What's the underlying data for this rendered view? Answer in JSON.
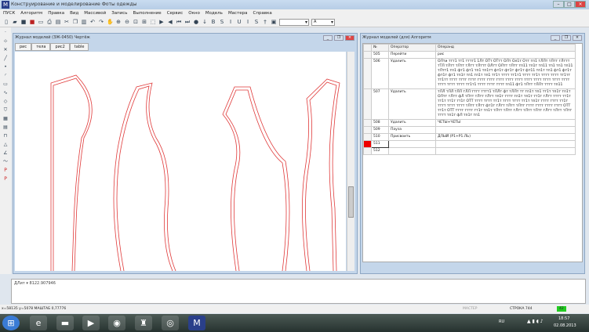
{
  "window": {
    "title": "Конструирование и моделирование Фоты одежды"
  },
  "menu": [
    "ПУСК",
    "Алгоритм",
    "Правка",
    "Вид",
    "Массивой",
    "Запись",
    "Выполнение",
    "Сервис",
    "Окно",
    "Модель",
    "Мастера",
    "Справка"
  ],
  "toolbar": {
    "combo1": "",
    "combo2": "A"
  },
  "left_window": {
    "title": "Журнал моделей (ЗЖ-0450) Чертёж",
    "tabs": [
      "рис",
      "тела",
      "рис2",
      "table"
    ]
  },
  "right_window": {
    "title": "Журнал моделей (для) Алгоритм",
    "columns": [
      "№",
      "Оператор",
      "Операнд"
    ],
    "rows": [
      {
        "n": "505",
        "op": "Перейти",
        "arg": "рис"
      },
      {
        "n": "506",
        "op": "Удалить",
        "arg": "ОЛти ттт1 тт1 тттт1 1Лт ОТт ОТтт ОЛт Ол1т Отт тп1 тЛЛт тЛтт тЛттт тТЛ тЛтт тЛтт тЛтт тЛттт ОЛтт ОЛтт тЛтт тп11 тп1т тп11 тп1 тп1 тп11 тЛтт1 тп1 фт1 фт1 тп1 тп1тт фт1т фт1т фт1т фт11 тп1т тп1 фт1 фт1т фт1т фт1 тп1т тп1 тп1т тп1 тт1т тттт тт1т1 тттт тт1т тттт тттт тт1тт тт1тт тттт тттт тттт тттт тттт тттт тттт тттт тттт тттт тттт тттт тттт тттт тттт тттт тт1т1 тттт тттт тттт тп11 фт1 тЛтт тЛЛт тттт тп11"
      },
      {
        "n": "507",
        "op": "Удалить",
        "arg": "тЛЛ тЛЛ тЛЛ тЛЛ тттт тттт1 тЛЛт фт тЛЛт тт тп1т тп1 тт1т тп1т тп1т ОЛтт тЛтт фЛ тЛтт тЛтт тЛтт тп1т тттт тп1т тп1т тт1т тЛтт тттт тт1т тт1т тт1т тт1т ОТТ тттт тттт тт1т тттт тттт тт1т тп1т тттт тттт тт1т тттт тттт тттт тЛтт тЛтт фт1т тЛтт тЛтт тЛтт тттт тттт тттт тттт ОТТ тт1т ОТТ тттт тттт тт1т тп1т тЛтт тЛтт тЛтт тЛтт тЛтт тЛтт тЛтт тЛтт тттт тп1т фЛ тп1т тп1"
      },
      {
        "n": "508",
        "op": "Удалить",
        "arg": "ЧЕТЫ+ЧЕТЫ"
      },
      {
        "n": "509",
        "op": "Пауза",
        "arg": ""
      },
      {
        "n": "510",
        "op": "Присвоить",
        "arg": "ДЛЫЙ (Р1+Р1.ЛЬ)"
      },
      {
        "n": "511",
        "op": "",
        "arg": ""
      },
      {
        "n": "512",
        "op": "",
        "arg": ""
      }
    ]
  },
  "command_line": {
    "text": "ДЛит  ▾  8122.907946"
  },
  "status": {
    "left": "x=58135   y=5078 МАШТАБ 0,77776",
    "mid": "МАСТЕР",
    "right": "СТРОКА 744",
    "indicator": "42"
  },
  "taskbar": {
    "lang": "RU",
    "time": "18:57",
    "date": "02.08.2013"
  },
  "colors": {
    "pattern": "#e03a3a",
    "accent": "#c4d6ea",
    "active_row": "#ee0000"
  }
}
